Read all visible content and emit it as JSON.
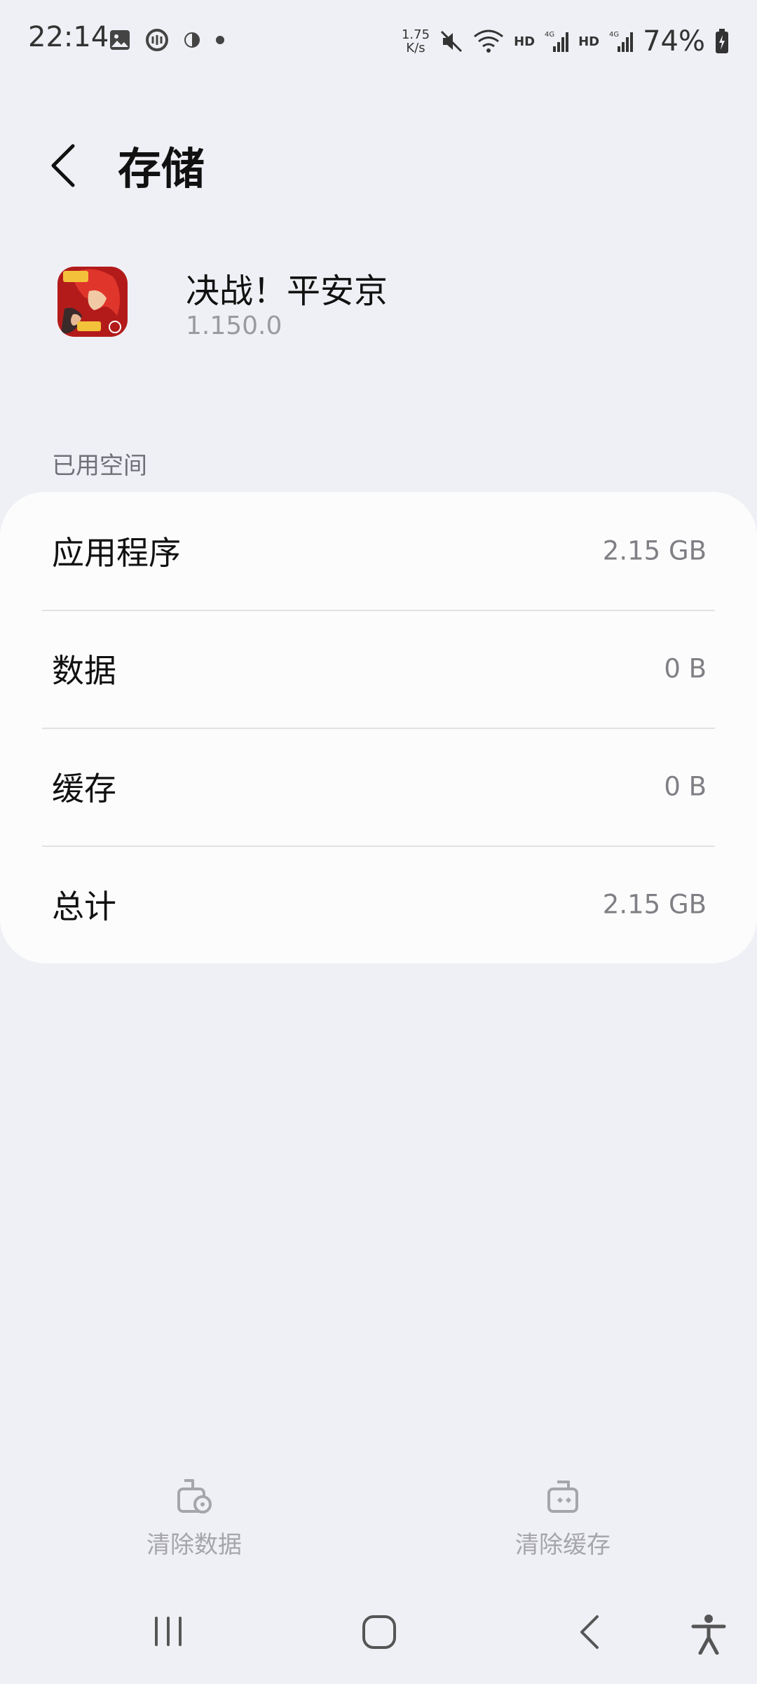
{
  "status_bar": {
    "time": "22:14",
    "speed_value": "1.75",
    "speed_unit": "K/s",
    "hd1": "HD",
    "hd2": "HD",
    "net1": "4G",
    "net2": "4G",
    "battery": "74%"
  },
  "header": {
    "title": "存储"
  },
  "app": {
    "name": "决战！平安京",
    "version": "1.150.0"
  },
  "section": {
    "label": "已用空间"
  },
  "storage_rows": [
    {
      "label": "应用程序",
      "value": "2.15 GB"
    },
    {
      "label": "数据",
      "value": "0 B"
    },
    {
      "label": "缓存",
      "value": "0 B"
    },
    {
      "label": "总计",
      "value": "2.15 GB"
    }
  ],
  "actions": {
    "clear_data": "清除数据",
    "clear_cache": "清除缓存"
  },
  "colors": {
    "background": "#eff0f5",
    "card": "#fcfcfc",
    "disabled_action": "#a5a5aa"
  }
}
